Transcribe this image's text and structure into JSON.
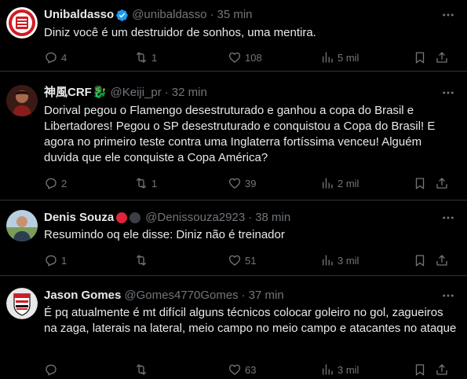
{
  "colors": {
    "background": "#000000",
    "text": "#e7e9ea",
    "muted": "#71767b",
    "divider": "#2f3336",
    "verified": "#1d9bf0"
  },
  "tweets": [
    {
      "name": "Unibaldasso",
      "handle": "@unibaldasso",
      "separator": "·",
      "time": "35 min",
      "verified": true,
      "text": "Diniz você é um destruidor de sonhos, uma mentira.",
      "replies": "4",
      "retweets": "1",
      "likes": "108",
      "views": "5 mil"
    },
    {
      "name": "神風CRF",
      "name_emoji": "🐉",
      "handle": "@Keiji_pr",
      "separator": "·",
      "time": "32 min",
      "text": "Dorival pegou o Flamengo desestruturado e ganhou a copa do Brasil e Libertadores! Pegou o SP desestruturado e conquistou a Copa do Brasil! E agora no primeiro teste contra uma Inglaterra fortíssima venceu! Alguém duvida que ele conquiste a Copa América?",
      "replies": "2",
      "retweets": "1",
      "likes": "39",
      "views": "2 mil"
    },
    {
      "name": "Denis Souza",
      "handle": "@Denissouza2923",
      "separator": "·",
      "time": "38 min",
      "text": "Resumindo oq ele disse: Diniz não é treinador",
      "replies": "1",
      "retweets": "",
      "likes": "51",
      "views": "3 mil"
    },
    {
      "name": "Jason Gomes",
      "handle": "@Gomes4770Gomes",
      "separator": "·",
      "time": "37 min",
      "text": "É pq atualmente é mt difícil alguns técnicos colocar goleiro no gol, zagueiros na zaga, laterais na lateral, meio campo no meio campo e atacantes no ataque",
      "replies": "",
      "retweets": "",
      "likes": "63",
      "views": "3 mil"
    }
  ],
  "icons": {
    "reply": "reply-icon",
    "retweet": "retweet-icon",
    "like": "like-icon",
    "views": "views-icon",
    "bookmark": "bookmark-icon",
    "share": "share-icon",
    "more": "more-icon",
    "verified": "verified-badge-icon"
  }
}
